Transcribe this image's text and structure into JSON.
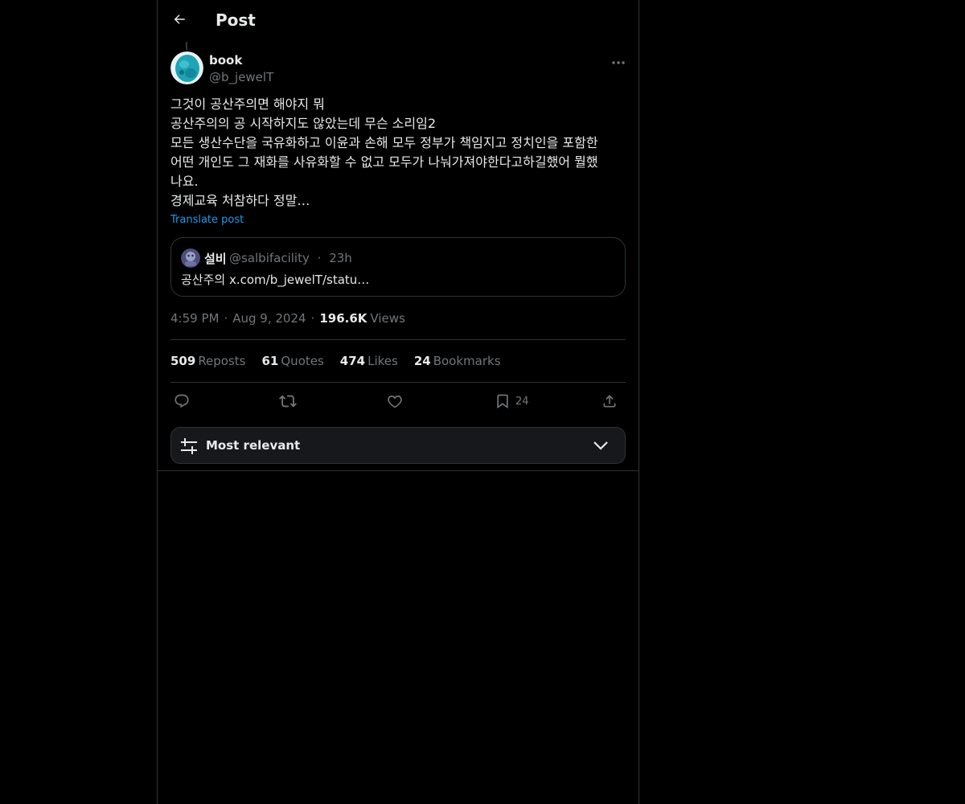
{
  "header": {
    "title": "Post",
    "back_icon": "arrow-left-icon"
  },
  "post": {
    "author": {
      "name": "book",
      "handle": "@b_jewelT",
      "avatar_color": "#1fa3b5"
    },
    "text": "그것이 공산주의면 해야지 뭐\n공산주의의 공 시작하지도 않았는데 무슨 소리임2\n모든 생산수단을 국유화하고 이윤과 손해 모두 정부가 책임지고 정치인을 포함한\n어떤 개인도 그 재화를 사유화할 수 없고 모두가 나눠가져야한다고하길했어 뭘했\n나요.\n경제교육 처참하다 정말…",
    "translate_label": "Translate post",
    "quote": {
      "name": "설비",
      "handle": "@salbifacility",
      "separator": "·",
      "time": "23h",
      "text": "공산주의 x.com/b_jewelT/statu…"
    },
    "meta": {
      "time": "4:59 PM",
      "sep": "·",
      "date": "Aug 9, 2024",
      "views": "196.6K",
      "views_label": "Views"
    },
    "stats": {
      "reposts": "509",
      "reposts_label": "Reposts",
      "quotes": "61",
      "quotes_label": "Quotes",
      "likes": "474",
      "likes_label": "Likes",
      "bookmarks": "24",
      "bookmarks_label": "Bookmarks"
    },
    "actions": {
      "bookmark_count": "24"
    }
  },
  "sort": {
    "label": "Most relevant"
  },
  "colors": {
    "background": "#000000",
    "text": "#e7e9ea",
    "muted": "#71767b",
    "link": "#1d9bf0",
    "border": "#2f3336"
  }
}
